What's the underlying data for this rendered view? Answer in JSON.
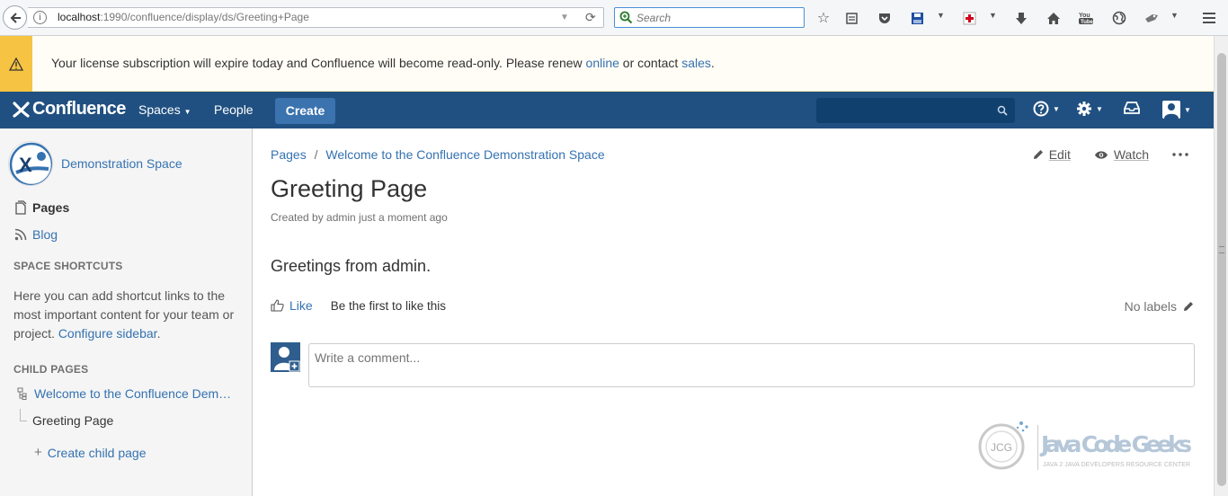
{
  "browser": {
    "url_host": "localhost",
    "url_path": ":1990/confluence/display/ds/Greeting+Page",
    "search_placeholder": "Search"
  },
  "license": {
    "message": "Your license subscription will expire today and Confluence will become read-only. Please renew ",
    "renew_link": "online",
    "middle": " or contact ",
    "sales_link": "sales",
    "end": "."
  },
  "header": {
    "logo": "Confluence",
    "nav_spaces": "Spaces",
    "nav_people": "People",
    "create_label": "Create"
  },
  "sidebar": {
    "space_name": "Demonstration Space",
    "pages_label": "Pages",
    "blog_label": "Blog",
    "shortcuts_heading": "SPACE SHORTCUTS",
    "shortcuts_text": "Here you can add shortcut links to the most important content for your team or project. ",
    "configure_link": "Configure sidebar",
    "shortcuts_end": ".",
    "child_pages_heading": "CHILD PAGES",
    "parent_page": "Welcome to the Confluence Dem…",
    "current_page": "Greeting Page",
    "create_child": "Create child page"
  },
  "main": {
    "breadcrumb_pages": "Pages",
    "breadcrumb_sep": "/",
    "breadcrumb_parent": "Welcome to the Confluence Demonstration Space",
    "edit_label": "Edit",
    "watch_label": "Watch",
    "title": "Greeting Page",
    "meta": "Created by admin just a moment ago",
    "body": "Greetings from admin.",
    "like_label": "Like",
    "like_text": "Be the first to like this",
    "labels_text": "No labels",
    "comment_placeholder": "Write a comment..."
  },
  "watermark": {
    "brand": "Java Code Geeks",
    "tagline": "JAVA 2 JAVA DEVELOPERS RESOURCE CENTER",
    "badge": "JCG"
  },
  "colors": {
    "header_bg": "#205081",
    "link": "#3572b0",
    "warning": "#f6c342",
    "create_btn": "#3b73af"
  }
}
